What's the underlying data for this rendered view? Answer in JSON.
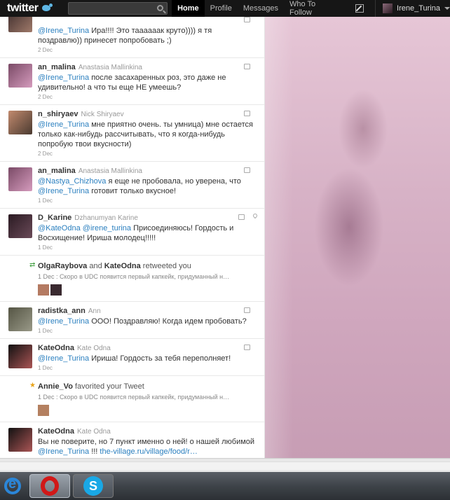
{
  "topbar": {
    "logo": "twitter",
    "search_placeholder": "",
    "nav": [
      "Home",
      "Profile",
      "Messages",
      "Who To Follow"
    ],
    "user": "Irene_Turina"
  },
  "tweets": [
    {
      "handle": "",
      "name": "",
      "text_pre": "",
      "mentions": [
        "@Irene_Turina"
      ],
      "text": " Ира!!!! Это таааааак круто)))) я тя поздравлю)) принесет попробовать ;)",
      "date": "2 Dec",
      "colors": [
        "#3b2b2b",
        "#a07a6a"
      ]
    },
    {
      "handle": "an_malina",
      "name": "Anastasia Mallinkina",
      "mentions": [
        "@Irene_Turina"
      ],
      "text": " после засахаренных роз, это даже не удивительно! а что ты еще НЕ умеешь?",
      "date": "2 Dec",
      "colors": [
        "#7a4a66",
        "#d59bbd"
      ]
    },
    {
      "handle": "n_shiryaev",
      "name": "Nick Shiryaev",
      "mentions": [
        "@Irene_Turina"
      ],
      "text": " мне приятно очень. ты умница) мне остается только как-нибудь рассчитывать, что я когда-нибудь попробую твои вкусности)",
      "date": "2 Dec",
      "colors": [
        "#c28a6e",
        "#4a3a30"
      ]
    },
    {
      "handle": "an_malina",
      "name": "Anastasia Mallinkina",
      "mentions": [
        "@Nastya_Chizhova",
        "@Irene_Turina"
      ],
      "text_mid": " я еще не пробовала, но уверена, что ",
      "text": " готовит только вкусное!",
      "date": "1 Dec",
      "colors": [
        "#7a4a66",
        "#d59bbd"
      ]
    },
    {
      "handle": "D_Karine",
      "name": "Dzhanumyan Karine",
      "mentions": [
        "@KateOdna",
        "@irene_turina"
      ],
      "text_mid": " ",
      "text": " Присоединяюсь! Гордость и Восхищение! Ириша молодец!!!!!",
      "date": "1 Dec",
      "colors": [
        "#2a1a22",
        "#6a4a58"
      ]
    }
  ],
  "retweet": {
    "users": [
      "OlgaRaybova",
      "KateOdna"
    ],
    "joiner": "and",
    "action": "retweeted you",
    "sub": "1 Dec : Скоро в UDC появится первый капкейк, придуманный н…",
    "thumb_colors": [
      "#b47a62",
      "#3a2a30"
    ]
  },
  "tweets2": [
    {
      "handle": "radistka_ann",
      "name": "Ann",
      "mentions": [
        "@Irene_Turina"
      ],
      "text": " ООО! Поздравляю! Когда идем пробовать?",
      "date": "1 Dec",
      "colors": [
        "#554",
        "#998"
      ]
    },
    {
      "handle": "KateOdna",
      "name": "Kate Odna",
      "mentions": [
        "@Irene_Turina"
      ],
      "text": " Ириша! Гордость за тебя переполняет!",
      "date": "1 Dec",
      "colors": [
        "#111",
        "#a55"
      ]
    }
  ],
  "favorite": {
    "user": "Annie_Vo",
    "action": "favorited your Tweet",
    "sub": "1 Dec : Скоро в UDC появится первый капкейк, придуманный н…",
    "thumb_colors": [
      "#b48060"
    ]
  },
  "last_tweet": {
    "handle": "KateOdna",
    "name": "Kate Odna",
    "text": "Вы не поверите, но 7 пункт именно о ней! о нашей любимой ",
    "mention": "@Irene_Turina",
    "mid": " !!! ",
    "link": "the-village.ru/village/food/r…",
    "colors": [
      "#111",
      "#a55"
    ]
  },
  "icons": {
    "retweet": "retweet-icon",
    "favorite": "star-icon",
    "reply": "reply-icon",
    "location": "location-icon"
  },
  "accent_colors": {
    "mention": "#2a7fbf",
    "topbar": "#161616",
    "retweet_green": "#3c9c3c",
    "star": "#e8a317"
  }
}
